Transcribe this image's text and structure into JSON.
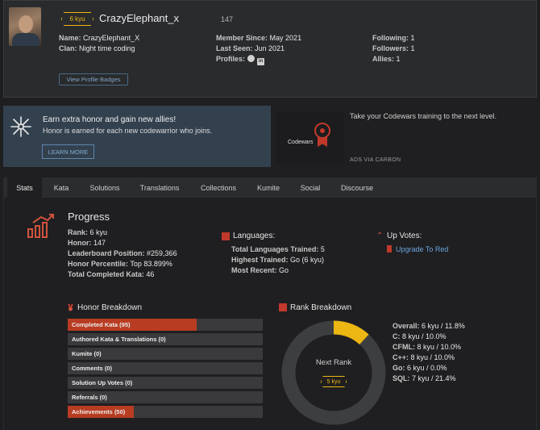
{
  "profile": {
    "kyu": "6 kyu",
    "username": "CrazyElephant_x",
    "honor": "147",
    "name_label": "Name:",
    "name_value": "CrazyElephant_X",
    "clan_label": "Clan:",
    "clan_value": "Night time coding",
    "member_label": "Member Since:",
    "member_value": "May 2021",
    "seen_label": "Last Seen:",
    "seen_value": "Jun 2021",
    "profiles_label": "Profiles:",
    "following_label": "Following:",
    "following_value": "1",
    "followers_label": "Followers:",
    "followers_value": "1",
    "allies_label": "Allies:",
    "allies_value": "1",
    "badges_button": "View Profile Badges"
  },
  "banner": {
    "title": "Earn extra honor and gain new allies!",
    "subtitle": "Honor is earned for each new codewarrior who joins.",
    "button": "LEARN MORE"
  },
  "ad": {
    "brand": "Codewars",
    "text": "Take your Codewars training to the next level.",
    "via": "ADS VIA CARBON"
  },
  "tabs": [
    "Stats",
    "Kata",
    "Solutions",
    "Translations",
    "Collections",
    "Kumite",
    "Social",
    "Discourse"
  ],
  "progress": {
    "title": "Progress",
    "rank_label": "Rank:",
    "rank_value": "6 kyu",
    "honor_label": "Honor:",
    "honor_value": "147",
    "leader_label": "Leaderboard Position:",
    "leader_value": "#259,366",
    "percentile_label": "Honor Percentile:",
    "percentile_value": "Top 83.899%",
    "completed_label": "Total Completed Kata:",
    "completed_value": "46"
  },
  "languages": {
    "title": "Languages:",
    "trained_label": "Total Languages Trained:",
    "trained_value": "5",
    "highest_label": "Highest Trained:",
    "highest_value": "Go (6 kyu)",
    "recent_label": "Most Recent:",
    "recent_value": "Go"
  },
  "upvotes": {
    "title": "Up Votes:",
    "link": "Upgrade To Red"
  },
  "honor_breakdown": {
    "title": "Honor Breakdown",
    "bars": [
      {
        "label": "Completed Kata (95)",
        "fraction": 0.66
      },
      {
        "label": "Authored Kata & Translations (0)",
        "fraction": 0
      },
      {
        "label": "Kumite (0)",
        "fraction": 0
      },
      {
        "label": "Comments (0)",
        "fraction": 0
      },
      {
        "label": "Solution Up Votes (0)",
        "fraction": 0
      },
      {
        "label": "Referrals (0)",
        "fraction": 0
      },
      {
        "label": "Achievements (50)",
        "fraction": 0.34
      }
    ]
  },
  "rank_breakdown": {
    "title": "Rank Breakdown",
    "next_rank_label": "Next Rank",
    "next_kyu": "5 kyu",
    "progress_fraction": 0.118,
    "colors": {
      "progress": "#ecb613",
      "track": "#3d3e40"
    },
    "items": [
      {
        "label": "Overall:",
        "value": "6 kyu / 11.8%"
      },
      {
        "label": "C:",
        "value": "8 kyu / 10.0%"
      },
      {
        "label": "CFML:",
        "value": "8 kyu / 10.0%"
      },
      {
        "label": "C++:",
        "value": "8 kyu / 10.0%"
      },
      {
        "label": "Go:",
        "value": "6 kyu / 0.0%"
      },
      {
        "label": "SQL:",
        "value": "7 kyu / 21.4%"
      }
    ]
  },
  "colors": {
    "accent": "#b83c22",
    "kyu": "#ecb613",
    "link": "#6aa6dd"
  }
}
